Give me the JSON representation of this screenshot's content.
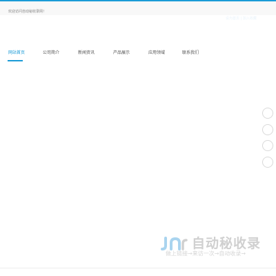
{
  "top_bar": {
    "welcome": "欢迎访问自动秘收录网！",
    "right_link": "设为首页 | 加入收藏"
  },
  "nav": {
    "items": [
      {
        "label": "网站首页",
        "active": true
      },
      {
        "label": "公司简介",
        "active": false
      },
      {
        "label": "新闻资讯",
        "active": false
      },
      {
        "label": "产品展示",
        "active": false
      },
      {
        "label": "应用领域",
        "active": false
      },
      {
        "label": "联系我们",
        "active": false
      }
    ]
  },
  "watermark": {
    "title": "自动秘收录",
    "subtitle": "做上链接→来访一次→自动收录→"
  },
  "colors": {
    "accent": "#1a9bd7",
    "text": "#555555",
    "watermark": "#d0d0d0"
  }
}
